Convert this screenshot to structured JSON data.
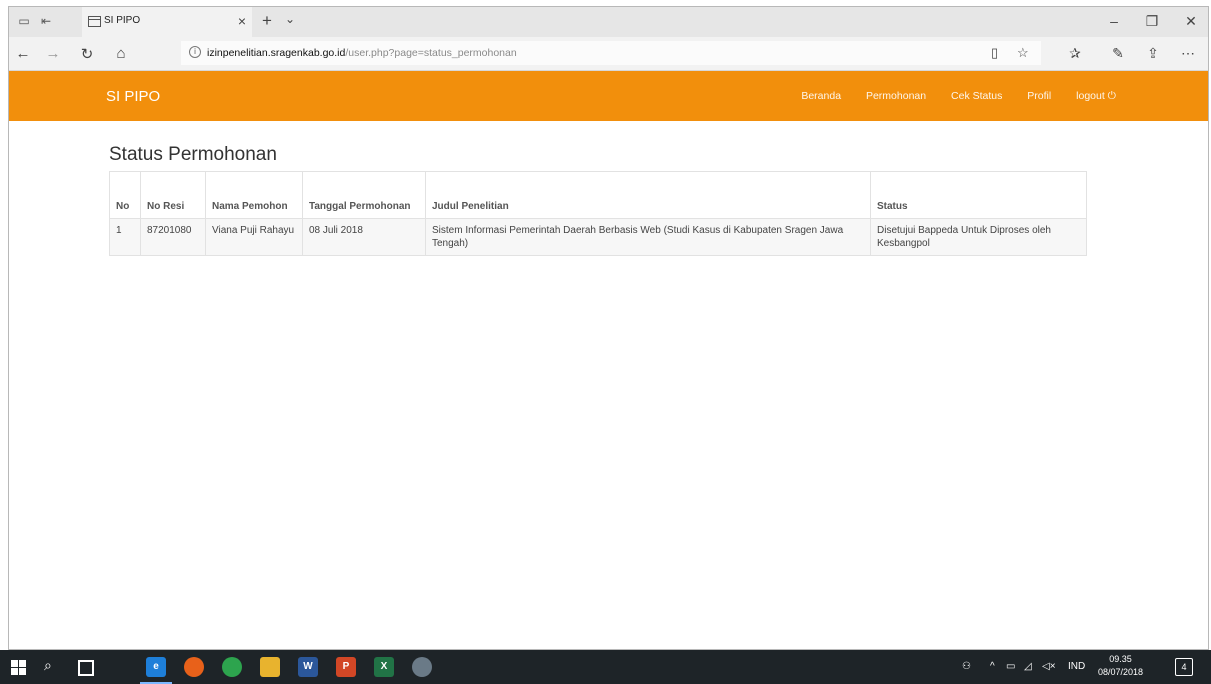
{
  "browser": {
    "tab_title": "SI PIPO",
    "url_host": "izinpenelitian.sragenkab.go.id",
    "url_path": "/user.php?page=status_permohonan"
  },
  "navbar": {
    "brand": "SI PIPO",
    "menu": [
      "Beranda",
      "Permohonan",
      "Cek Status",
      "Profil",
      "logout ⏻"
    ],
    "bg_color": "#f28f0c"
  },
  "page": {
    "title": "Status Permohonan"
  },
  "table": {
    "headers": [
      "No",
      "No Resi",
      "Nama Pemohon",
      "Tanggal Permohonan",
      "Judul Penelitian",
      "Status"
    ],
    "rows": [
      [
        "1",
        "87201080",
        "Viana Puji Rahayu",
        "08 Juli 2018",
        "Sistem Informasi Pemerintah Daerah Berbasis Web (Studi Kasus di Kabupaten Sragen Jawa Tengah)",
        "Disetujui Bappeda Untuk Diproses oleh Kesbangpol"
      ]
    ]
  },
  "taskbar": {
    "tray_lang": "IND",
    "time": "09.35",
    "date": "08/07/2018",
    "notification_count": "4"
  }
}
